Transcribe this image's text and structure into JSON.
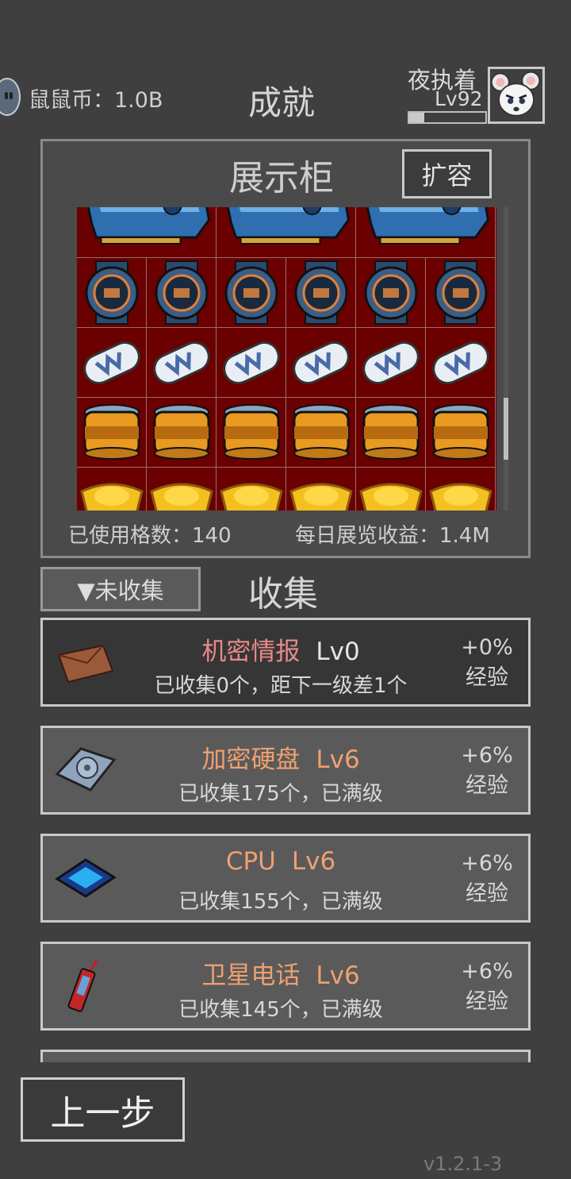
{
  "header": {
    "coin_text": "鼠鼠币：1.0B",
    "title": "成就",
    "player_name": "夜执着",
    "player_level": "Lv92",
    "xp_progress": 0.2
  },
  "showcase": {
    "title": "展示柜",
    "expand_label": "扩容",
    "used_slots": "已使用格数：140",
    "daily_income": "每日展览收益：1.4M",
    "rows": [
      {
        "item": "graphics-card",
        "count": 3
      },
      {
        "item": "smart-watch",
        "count": 6
      },
      {
        "item": "capsule-pill",
        "count": 6
      },
      {
        "item": "gold-jar",
        "count": 6
      },
      {
        "item": "gold-ingot",
        "count": 6
      }
    ]
  },
  "collection": {
    "filter_label": "▼未收集",
    "title": "收集",
    "items": [
      {
        "name": "机密情报",
        "level": "Lv0",
        "detail": "已收集0个，距下一级差1个",
        "bonus": "+0%",
        "bonus_label": "经验",
        "icon": "envelope-icon",
        "name_color": "#e88a8a",
        "level_color": "#e6e6e6"
      },
      {
        "name": "加密硬盘",
        "level": "Lv6",
        "detail": "已收集175个，已满级",
        "bonus": "+6%",
        "bonus_label": "经验",
        "icon": "hard-drive-icon",
        "name_color": "#f0a070",
        "level_color": "#f0a070"
      },
      {
        "name": "CPU",
        "level": "Lv6",
        "detail": "已收集155个，已满级",
        "bonus": "+6%",
        "bonus_label": "经验",
        "icon": "cpu-chip-icon",
        "name_color": "#f0a070",
        "level_color": "#f0a070"
      },
      {
        "name": "卫星电话",
        "level": "Lv6",
        "detail": "已收集145个，已满级",
        "bonus": "+6%",
        "bonus_label": "经验",
        "icon": "satellite-phone-icon",
        "name_color": "#f0a070",
        "level_color": "#f0a070"
      }
    ]
  },
  "footer": {
    "back_label": "上一步",
    "version": "v1.2.1-3"
  }
}
